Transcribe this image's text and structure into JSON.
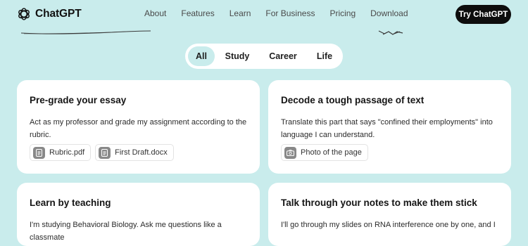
{
  "header": {
    "brand": "ChatGPT",
    "nav": [
      "About",
      "Features",
      "Learn",
      "For Business",
      "Pricing",
      "Download"
    ],
    "cta_label": "Try ChatGPT"
  },
  "filters": {
    "options": [
      "All",
      "Study",
      "Career",
      "Life"
    ],
    "selected": "All"
  },
  "cards": [
    {
      "title": "Pre-grade your essay",
      "description": "Act as my professor and grade my assignment according to the rubric.",
      "attachments": [
        {
          "label": "Rubric.pdf",
          "icon": "document-icon"
        },
        {
          "label": "First Draft.docx",
          "icon": "document-icon"
        }
      ]
    },
    {
      "title": "Decode a tough passage of text",
      "description": "Translate this part that says \"confined their employments\" into language I can understand.",
      "attachments": [
        {
          "label": "Photo of the page",
          "icon": "camera-icon"
        }
      ]
    },
    {
      "title": "Learn by teaching",
      "description": "I'm studying Behavioral Biology. Ask me questions like a classmate"
    },
    {
      "title": "Talk through your notes to make them stick",
      "description": "I'll go through my slides on RNA interference one by one, and I"
    }
  ],
  "colors": {
    "background": "#c9ecec",
    "card": "#ffffff",
    "cta": "#0d0d0d",
    "active_pill": "#c9ecec",
    "chip_icon": "#888888"
  }
}
